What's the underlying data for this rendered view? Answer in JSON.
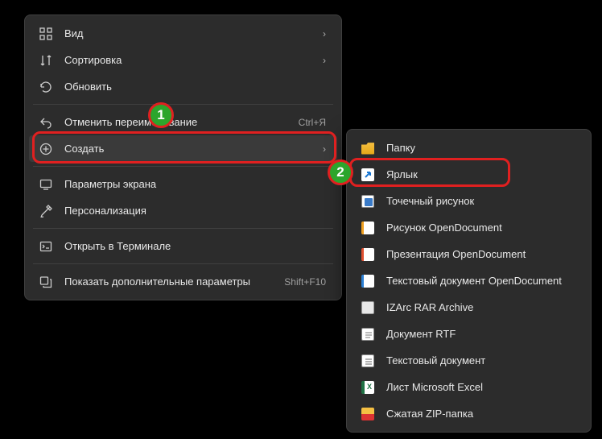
{
  "primary": {
    "items": [
      {
        "label": "Вид",
        "shortcut": "",
        "arrow": true
      },
      {
        "label": "Сортировка",
        "shortcut": "",
        "arrow": true
      },
      {
        "label": "Обновить",
        "shortcut": "",
        "arrow": false
      },
      {
        "label": "Отменить переименование",
        "shortcut": "Ctrl+Я",
        "arrow": false
      },
      {
        "label": "Создать",
        "shortcut": "",
        "arrow": true
      },
      {
        "label": "Параметры экрана",
        "shortcut": "",
        "arrow": false
      },
      {
        "label": "Персонализация",
        "shortcut": "",
        "arrow": false
      },
      {
        "label": "Открыть в Терминале",
        "shortcut": "",
        "arrow": false
      },
      {
        "label": "Показать дополнительные параметры",
        "shortcut": "Shift+F10",
        "arrow": false
      }
    ]
  },
  "secondary": {
    "items": [
      {
        "label": "Папку"
      },
      {
        "label": "Ярлык"
      },
      {
        "label": "Точечный рисунок"
      },
      {
        "label": "Рисунок OpenDocument"
      },
      {
        "label": "Презентация OpenDocument"
      },
      {
        "label": "Текстовый документ OpenDocument"
      },
      {
        "label": "IZArc RAR Archive"
      },
      {
        "label": "Документ RTF"
      },
      {
        "label": "Текстовый документ"
      },
      {
        "label": "Лист Microsoft Excel"
      },
      {
        "label": "Сжатая ZIP-папка"
      }
    ]
  },
  "annotations": {
    "badge1": "1",
    "badge2": "2"
  }
}
